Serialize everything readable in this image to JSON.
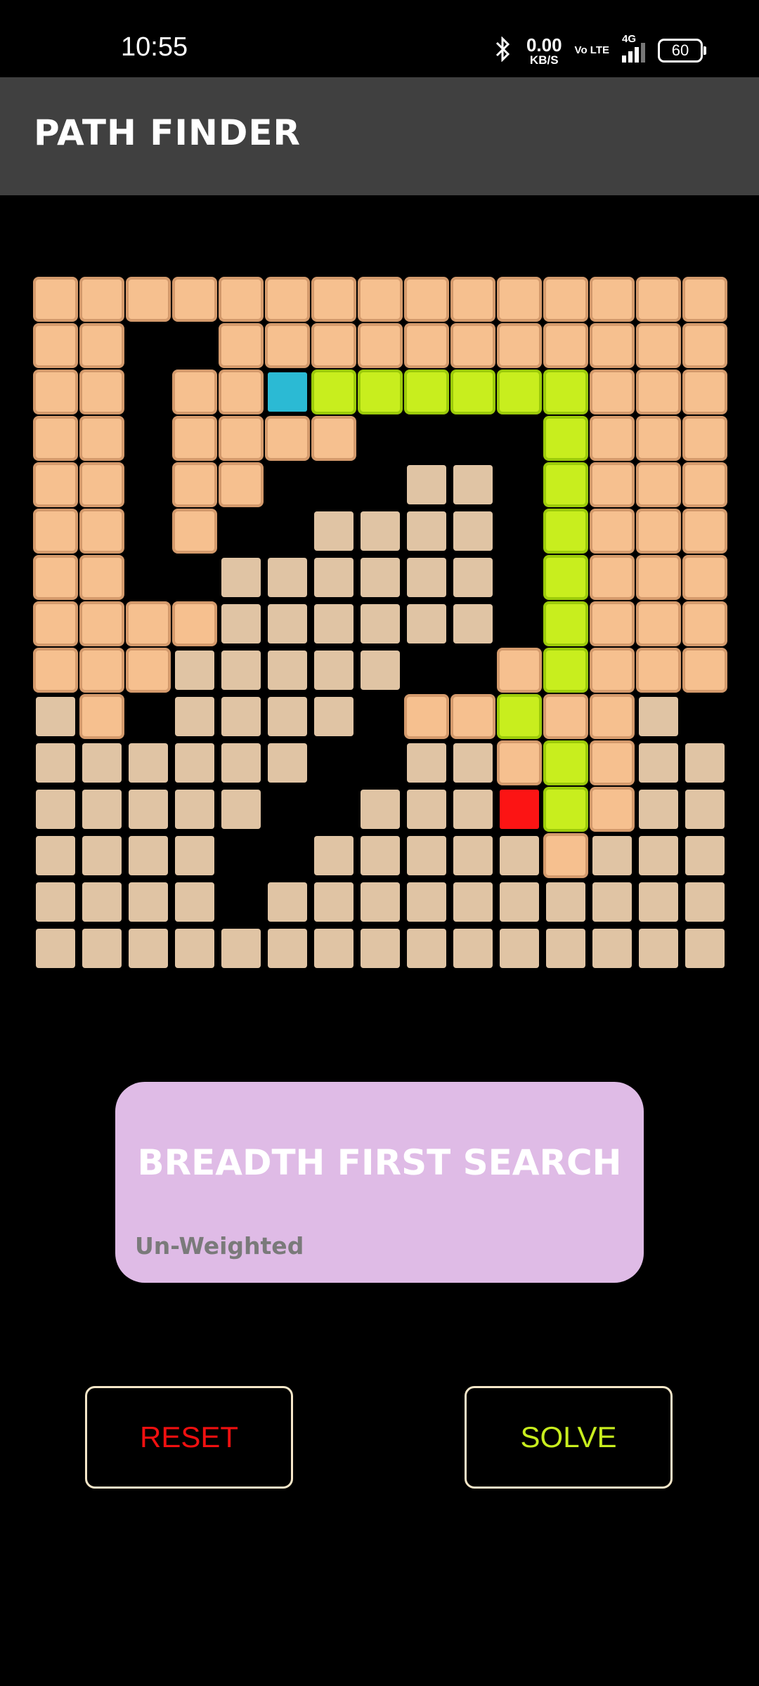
{
  "status_bar": {
    "time": "10:55",
    "net_speed_value": "0.00",
    "net_speed_unit": "KB/S",
    "volte": "Vo LTE",
    "network": "4G",
    "battery": "60",
    "icons": [
      "bluetooth-icon",
      "signal-icon",
      "battery-icon"
    ]
  },
  "app_bar": {
    "title": "PATH FINDER"
  },
  "grid": {
    "rows": 15,
    "cols": 15,
    "legend": {
      "V": "visited",
      "P": "path",
      "S": "start",
      "E": "end",
      ".": "empty",
      " ": "wall"
    },
    "colors": {
      "visited": "#f6c08f",
      "path": "#c8ee1e",
      "start": "#2bbad4",
      "end": "#fc1414",
      "empty": "#e0c4a4",
      "background": "#000000"
    },
    "cells": [
      "VVVVVVVVVVVVVVV",
      "VV  VVVVVVVVVVV",
      "VV VVSPPPPPPVVV",
      "VV VVVV    PVVV",
      "VV VV   .. PVVV",
      "VV V  .... PVVV",
      "VV  ...... PVVV",
      "VVVV...... PVVV",
      "VVV.....  VPVVV",
      ".V .... VVPVV. ",
      "......  ..VPV..",
      ".....  ...EPV..",
      "....  .....V...",
      ".... ..........",
      "..............."
    ]
  },
  "algorithm_card": {
    "title": "BREADTH FIRST SEARCH",
    "subtitle": "Un-Weighted",
    "background": "#dfbbe6"
  },
  "buttons": {
    "reset": "RESET",
    "solve": "SOLVE"
  }
}
